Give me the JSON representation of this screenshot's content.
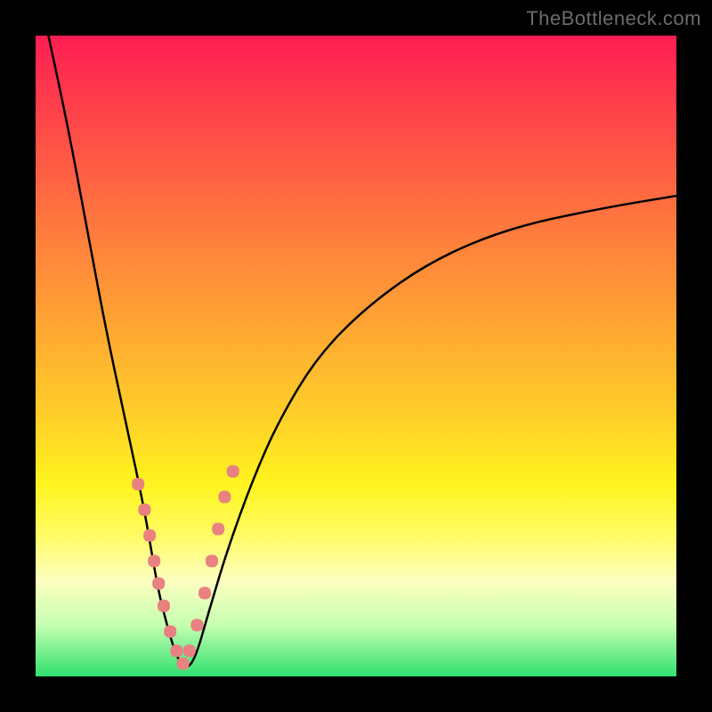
{
  "watermark": "TheBottleneck.com",
  "chart_data": {
    "type": "line",
    "title": "",
    "xlabel": "",
    "ylabel": "",
    "xlim": [
      0,
      100
    ],
    "ylim": [
      0,
      100
    ],
    "series": [
      {
        "name": "bottleneck-curve",
        "x": [
          2,
          5,
          8,
          11,
          14,
          17,
          19,
          20.5,
          22,
          23.5,
          25,
          27,
          30,
          34,
          38,
          44,
          52,
          62,
          74,
          88,
          100
        ],
        "y": [
          100,
          86,
          70,
          54,
          40,
          26,
          14,
          8,
          3,
          1,
          3,
          10,
          20,
          31,
          40,
          50,
          58,
          65,
          70,
          73,
          75
        ]
      },
      {
        "name": "highlight-dots",
        "x": [
          16,
          17,
          17.8,
          18.5,
          19.2,
          20,
          21,
          22,
          23,
          24,
          25.2,
          26.4,
          27.5,
          28.5,
          29.5,
          30.8
        ],
        "y": [
          30,
          26,
          22,
          18,
          14.5,
          11,
          7,
          4,
          2,
          4,
          8,
          13,
          18,
          23,
          28,
          32
        ]
      }
    ],
    "gradient_bands": [
      "#ff1d53",
      "#ff7a3e",
      "#ffd128",
      "#fff41e",
      "#30e070"
    ]
  }
}
